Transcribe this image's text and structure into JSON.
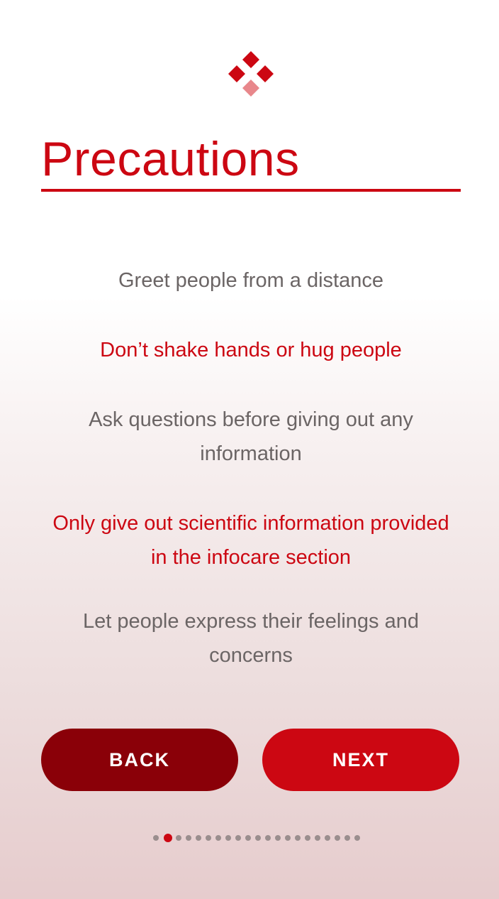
{
  "brand": {
    "logo_icon": "red-diamond-cluster-icon",
    "primary_color": "#cc0712",
    "dark_color": "#8a0008",
    "light_color": "#e8878b"
  },
  "page": {
    "title": "Precautions"
  },
  "tips": [
    {
      "text": "Greet people from a distance",
      "color": "gray"
    },
    {
      "text": "Don’t shake hands or hug people",
      "color": "red"
    },
    {
      "text": "Ask questions before giving out any information",
      "color": "gray"
    },
    {
      "text": "Only give out scientific information provided in the infocare section",
      "color": "red"
    },
    {
      "text": "Let people express their feelings and concerns",
      "color": "gray"
    }
  ],
  "navigation": {
    "back_label": "BACK",
    "next_label": "NEXT"
  },
  "pager": {
    "total_pages": 21,
    "current_page": 2
  }
}
